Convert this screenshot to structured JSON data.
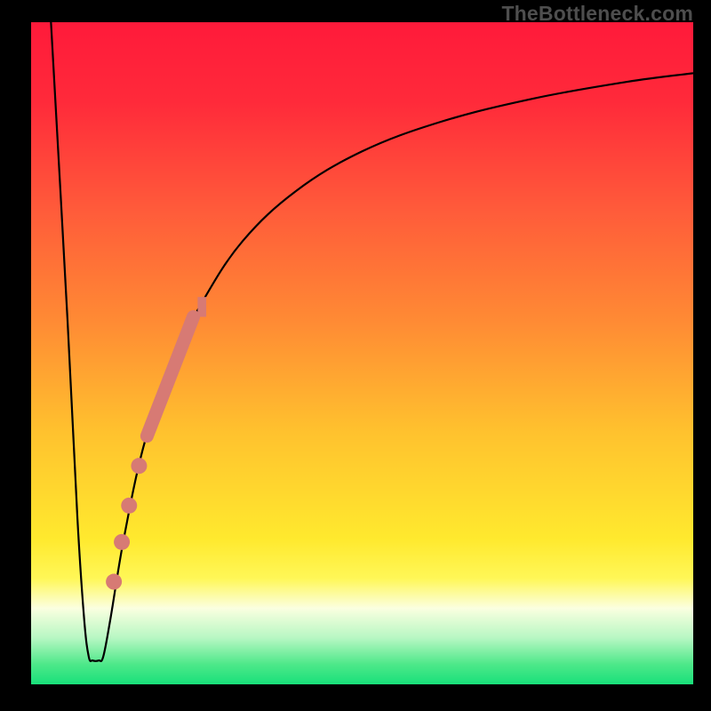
{
  "watermark": "TheBottleneck.com",
  "chart_data": {
    "type": "line",
    "title": "",
    "xlabel": "",
    "ylabel": "",
    "xlim": [
      0,
      100
    ],
    "ylim": [
      0,
      100
    ],
    "background_gradient_stops": [
      {
        "offset": 0,
        "color": "#ff1a3a"
      },
      {
        "offset": 0.12,
        "color": "#ff2a3a"
      },
      {
        "offset": 0.28,
        "color": "#ff5a3a"
      },
      {
        "offset": 0.45,
        "color": "#ff8a34"
      },
      {
        "offset": 0.62,
        "color": "#ffc22e"
      },
      {
        "offset": 0.78,
        "color": "#ffe92e"
      },
      {
        "offset": 0.84,
        "color": "#fff757"
      },
      {
        "offset": 0.885,
        "color": "#fbffe0"
      },
      {
        "offset": 0.93,
        "color": "#b7f7c3"
      },
      {
        "offset": 0.97,
        "color": "#4de889"
      },
      {
        "offset": 1.0,
        "color": "#18e07a"
      }
    ],
    "series": [
      {
        "name": "bottleneck-curve",
        "stroke": "#000000",
        "stroke_width": 2.2,
        "points": [
          {
            "x": 3.0,
            "y": 100.0
          },
          {
            "x": 5.5,
            "y": 55.0
          },
          {
            "x": 7.0,
            "y": 25.0
          },
          {
            "x": 8.0,
            "y": 10.0
          },
          {
            "x": 8.7,
            "y": 4.2
          },
          {
            "x": 9.3,
            "y": 3.6
          },
          {
            "x": 10.2,
            "y": 3.6
          },
          {
            "x": 10.9,
            "y": 4.2
          },
          {
            "x": 12.0,
            "y": 10.0
          },
          {
            "x": 14.0,
            "y": 22.0
          },
          {
            "x": 17.0,
            "y": 36.0
          },
          {
            "x": 21.0,
            "y": 48.0
          },
          {
            "x": 26.0,
            "y": 58.0
          },
          {
            "x": 32.0,
            "y": 67.0
          },
          {
            "x": 40.0,
            "y": 74.5
          },
          {
            "x": 50.0,
            "y": 80.5
          },
          {
            "x": 62.0,
            "y": 85.0
          },
          {
            "x": 76.0,
            "y": 88.5
          },
          {
            "x": 90.0,
            "y": 91.0
          },
          {
            "x": 100.0,
            "y": 92.3
          }
        ]
      },
      {
        "name": "thick-pink-segment",
        "stroke": "#d77a74",
        "stroke_width": 15,
        "cap": "round",
        "points": [
          {
            "x": 17.5,
            "y": 37.5
          },
          {
            "x": 24.5,
            "y": 55.5
          }
        ]
      }
    ],
    "scatter": {
      "name": "pink-dots",
      "color": "#d77a74",
      "radius": 9,
      "points": [
        {
          "x": 16.3,
          "y": 33.0
        },
        {
          "x": 14.8,
          "y": 27.0
        },
        {
          "x": 13.7,
          "y": 21.5
        },
        {
          "x": 12.5,
          "y": 15.5
        }
      ]
    },
    "extra_marks": [
      {
        "name": "pink-tick-top",
        "color": "#d77a74",
        "x": 25.8,
        "y": 55.5,
        "w": 1.3,
        "h": 3.0
      }
    ]
  }
}
